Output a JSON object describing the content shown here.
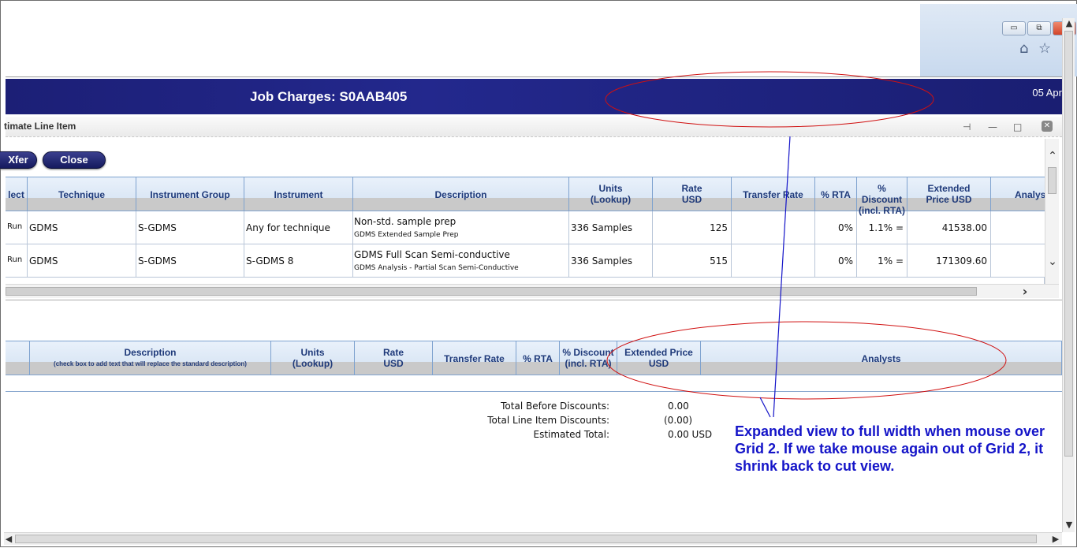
{
  "window": {
    "minimize": "_",
    "restore": "□",
    "close": "✕"
  },
  "browser": {
    "btn_min": "▭",
    "btn_restore": "⧉",
    "home_icon": "⌂",
    "star_icon": "☆"
  },
  "header": {
    "title": "Job Charges: S0AAB405",
    "date": "05 Apr"
  },
  "panel": {
    "title": "timate Line Item",
    "tools": {
      "pin": "⊣",
      "minimize": "—",
      "maximize": "□",
      "close": "✕"
    },
    "buttons": {
      "xfer": "Xfer",
      "close": "Close"
    }
  },
  "grid1": {
    "headers": [
      {
        "l1": "lect",
        "l2": ""
      },
      {
        "l1": "Technique",
        "l2": ""
      },
      {
        "l1": "Instrument Group",
        "l2": ""
      },
      {
        "l1": "Instrument",
        "l2": ""
      },
      {
        "l1": "Description",
        "l2": ""
      },
      {
        "l1": "Units",
        "l2": "(Lookup)"
      },
      {
        "l1": "Rate",
        "l2": "USD"
      },
      {
        "l1": "Transfer Rate",
        "l2": ""
      },
      {
        "l1": "% RTA",
        "l2": ""
      },
      {
        "l1": "% Discount",
        "l2": "(incl. RTA)"
      },
      {
        "l1": "Extended",
        "l2": "Price USD"
      },
      {
        "l1": "Analyst",
        "l2": ""
      }
    ],
    "rows": [
      {
        "select": "Run",
        "technique": "GDMS",
        "group": "S-GDMS",
        "instrument": "Any for technique",
        "desc1": "Non-std. sample prep",
        "desc2": "GDMS Extended Sample Prep",
        "units": "336 Samples",
        "rate": "125",
        "transfer": "",
        "rta": "0%",
        "discount": "1.1% =",
        "extended": "41538.00"
      },
      {
        "select": "Run",
        "technique": "GDMS",
        "group": "S-GDMS",
        "instrument": "S-GDMS 8",
        "desc1": "GDMS Full Scan Semi-conductive",
        "desc2": "GDMS Analysis - Partial Scan Semi-Conductive",
        "units": "336 Samples",
        "rate": "515",
        "transfer": "",
        "rta": "0%",
        "discount": "1% =",
        "extended": "171309.60"
      }
    ],
    "scroll": {
      "up": "⌃",
      "down": "⌄",
      "right": "›"
    }
  },
  "grid2": {
    "headers": [
      {
        "l1": "Description",
        "l2": "(check box to add text that will replace the standard description)"
      },
      {
        "l1": "Units",
        "l2": "(Lookup)"
      },
      {
        "l1": "Rate",
        "l2": "USD"
      },
      {
        "l1": "Transfer Rate",
        "l2": ""
      },
      {
        "l1": "% RTA",
        "l2": ""
      },
      {
        "l1": "% Discount",
        "l2": "(incl. RTA)"
      },
      {
        "l1": "Extended Price",
        "l2": "USD"
      },
      {
        "l1": "Analysts",
        "l2": ""
      }
    ]
  },
  "totals": {
    "before_label": "Total Before Discounts:",
    "before_value": "0.00",
    "discounts_label": "Total Line Item Discounts:",
    "discounts_value": "(0.00)",
    "estimated_label": "Estimated Total:",
    "estimated_value": "0.00 USD"
  },
  "annotation": "Expanded view to full width when mouse over Grid 2. If we take mouse again out of Grid 2, it shrink back to cut view.",
  "colors": {
    "header_bg": "#1c1f76",
    "annotation": "#1414c8",
    "ellipse": "#d01010",
    "grid_header_text": "#1f3a7a"
  }
}
